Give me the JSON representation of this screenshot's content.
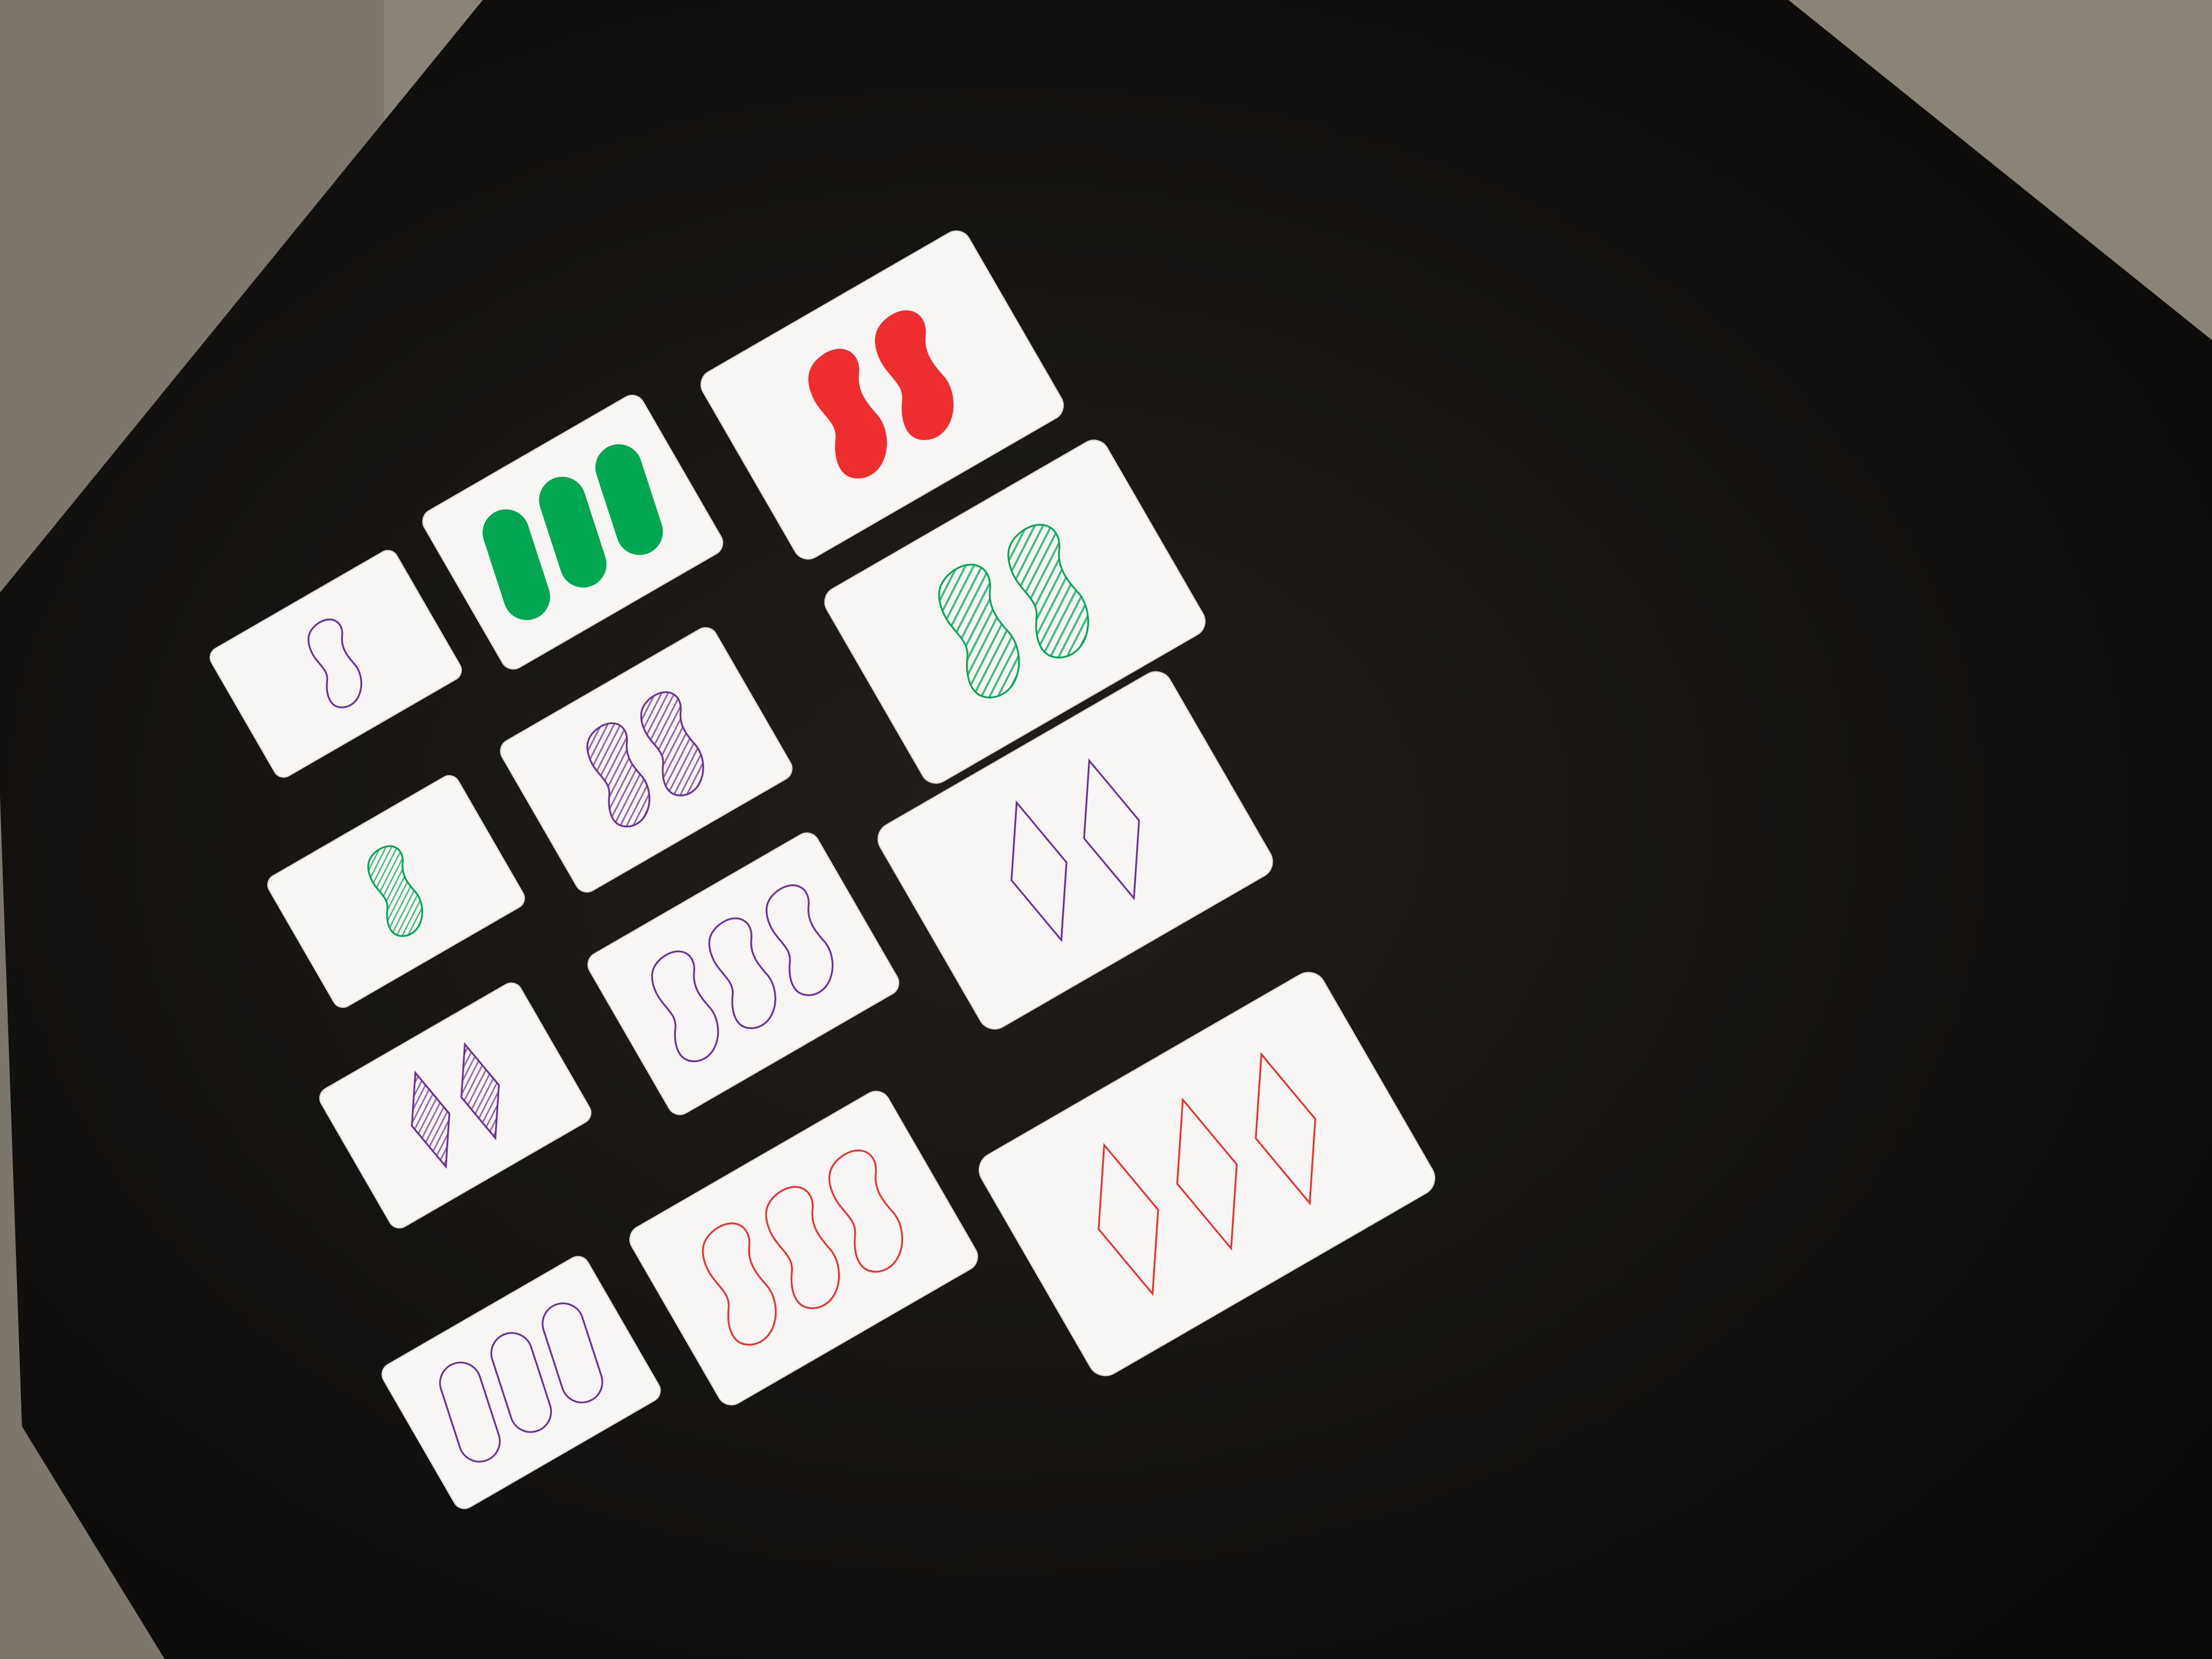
{
  "colors": {
    "carpet": "#8a8378",
    "table": "#15120f",
    "card": "#f7f6f4",
    "red": "#ee2e2e",
    "green": "#00a651",
    "purple": "#6a2f94"
  },
  "game": "Set card game",
  "cards": [
    {
      "id": "c1",
      "count": 1,
      "color": "purple",
      "shape": "squiggle",
      "fill": "open"
    },
    {
      "id": "c2",
      "count": 3,
      "color": "green",
      "shape": "oval",
      "fill": "solid"
    },
    {
      "id": "c3",
      "count": 2,
      "color": "red",
      "shape": "squiggle",
      "fill": "solid"
    },
    {
      "id": "c4",
      "count": 1,
      "color": "green",
      "shape": "squiggle",
      "fill": "striped"
    },
    {
      "id": "c5",
      "count": 2,
      "color": "purple",
      "shape": "squiggle",
      "fill": "striped"
    },
    {
      "id": "c6",
      "count": 2,
      "color": "green",
      "shape": "squiggle",
      "fill": "striped"
    },
    {
      "id": "c7",
      "count": 2,
      "color": "purple",
      "shape": "diamond",
      "fill": "striped"
    },
    {
      "id": "c8",
      "count": 3,
      "color": "purple",
      "shape": "squiggle",
      "fill": "open"
    },
    {
      "id": "c9",
      "count": 2,
      "color": "purple",
      "shape": "diamond",
      "fill": "open"
    },
    {
      "id": "c10",
      "count": 3,
      "color": "purple",
      "shape": "oval",
      "fill": "open"
    },
    {
      "id": "c11",
      "count": 3,
      "color": "red",
      "shape": "squiggle",
      "fill": "open"
    },
    {
      "id": "c12",
      "count": 3,
      "color": "red",
      "shape": "diamond",
      "fill": "open"
    }
  ]
}
